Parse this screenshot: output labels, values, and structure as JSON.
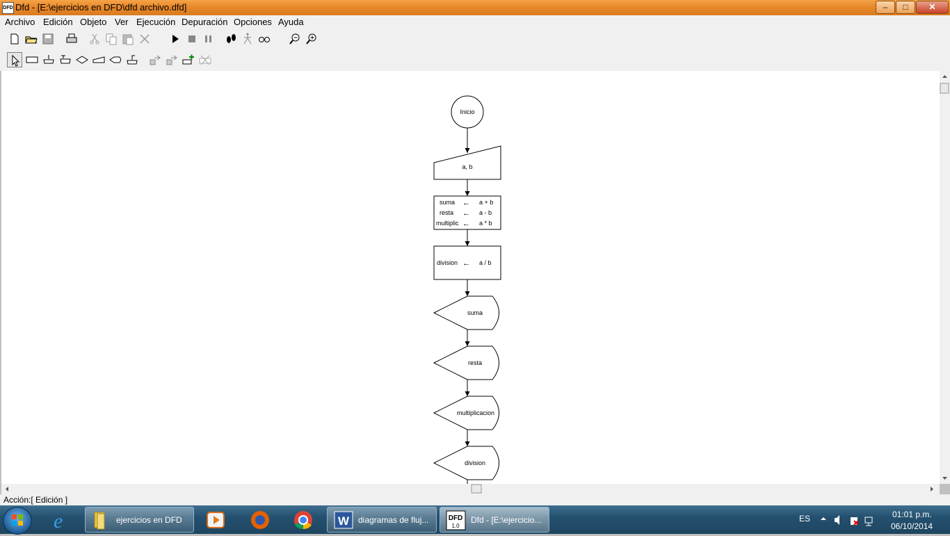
{
  "window": {
    "title": "Dfd - [E:\\ejercicios en DFD\\dfd archivo.dfd]",
    "icon_text": "DFD",
    "controls": {
      "minimize": "‒",
      "maximize": "□",
      "close": "✕"
    }
  },
  "menu": [
    "Archivo",
    "Edición",
    "Objeto",
    "Ver",
    "Ejecución",
    "Depuración",
    "Opciones",
    "Ayuda"
  ],
  "toolbar1": [
    "new-file-icon",
    "open-folder-icon",
    "save-icon",
    "print-icon",
    "cut-icon",
    "copy-icon",
    "paste-icon",
    "delete-icon",
    "run-icon",
    "stop-icon",
    "pause-icon",
    "step-icon",
    "trace-icon",
    "watch-icon",
    "zoom-out-icon",
    "zoom-in-icon"
  ],
  "toolbar2": [
    "cursor-icon",
    "assignment-icon",
    "read-icon",
    "loop-icon",
    "decision-icon",
    "input-icon",
    "output-icon",
    "subprogram-icon",
    "insert-icon-1",
    "insert-icon-2",
    "add-object-icon",
    "remove-object-icon"
  ],
  "flowchart": {
    "start": "Inicio",
    "read": "a, b",
    "assign1": [
      {
        "var": "suma",
        "arrow": "←",
        "expr": "a + b"
      },
      {
        "var": "resta",
        "arrow": "←",
        "expr": "a - b"
      },
      {
        "var": "multiplic",
        "arrow": "←",
        "expr": "a * b"
      }
    ],
    "assign2": [
      {
        "var": "division",
        "arrow": "←",
        "expr": "a /  b"
      }
    ],
    "outputs": [
      "suma",
      "resta",
      "multiplicacion",
      "division"
    ]
  },
  "status": "Acción:[ Edición ]",
  "taskbar": {
    "items": [
      {
        "label": "ejercicios en DFD",
        "icon": "folder-icon"
      },
      {
        "label": "diagramas de fluj...",
        "icon": "word-icon"
      },
      {
        "label": "Dfd - [E:\\ejercicio...",
        "icon": "dfd-icon"
      }
    ],
    "dfd_icon_text": "DFD",
    "dfd_icon_ver": "1.0",
    "word_icon_text": "W",
    "lang": "ES",
    "time": "01:01 p.m.",
    "date": "06/10/2014"
  },
  "colors": {
    "titlebar": "#e8892b",
    "taskbar": "#24516f",
    "chrome": "#f0f0f0",
    "canvas": "#ffffff"
  }
}
